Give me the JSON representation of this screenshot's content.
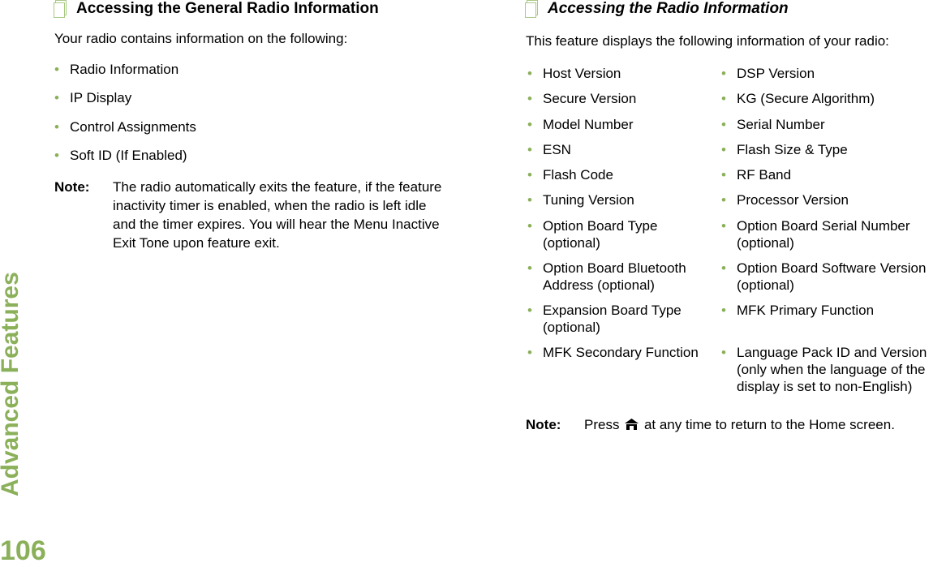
{
  "sidebar": {
    "section_title": "Advanced Features",
    "page_number": "106"
  },
  "left": {
    "heading": "Accessing the General Radio Information",
    "intro": "Your radio contains information on the following:",
    "items": [
      "Radio Information",
      "IP Display",
      "Control Assignments",
      "Soft ID (If Enabled)"
    ],
    "note_label": "Note:",
    "note_lines": [
      "The radio automatically exits the feature, if the feature",
      "inactivity timer is enabled, when the radio is left idle",
      "and the timer expires. You will hear the Menu Inactive",
      "Exit Tone upon feature exit."
    ]
  },
  "right": {
    "heading": "Accessing the Radio Information",
    "intro": "This feature displays the following information of your radio:",
    "col1": [
      [
        "Host Version"
      ],
      [
        "Secure Version"
      ],
      [
        "Model Number"
      ],
      [
        "ESN"
      ],
      [
        "Flash Code"
      ],
      [
        "Tuning Version"
      ],
      [
        "Option Board Type",
        "(optional)"
      ],
      [
        "Option Board Bluetooth",
        "Address (optional)"
      ],
      [
        "Expansion Board Type",
        "(optional)"
      ],
      [
        "MFK Secondary Function"
      ]
    ],
    "col2": [
      [
        "DSP Version"
      ],
      [
        "KG (Secure Algorithm)"
      ],
      [
        "Serial Number"
      ],
      [
        "Flash Size & Type"
      ],
      [
        "RF Band"
      ],
      [
        "Processor Version"
      ],
      [
        "Option Board Serial Number",
        "(optional)"
      ],
      [
        "Option Board Software Version",
        "(optional)"
      ],
      [
        "MFK Primary Function"
      ],
      [
        "Language Pack ID and Version",
        "(only when the language of the",
        "display is set to non-English)"
      ]
    ],
    "note_label": "Note:",
    "note_before": "Press",
    "note_icon": "home-icon",
    "note_after": "at any time to return to the Home screen."
  },
  "colors": {
    "accent": "#8bb05a"
  }
}
